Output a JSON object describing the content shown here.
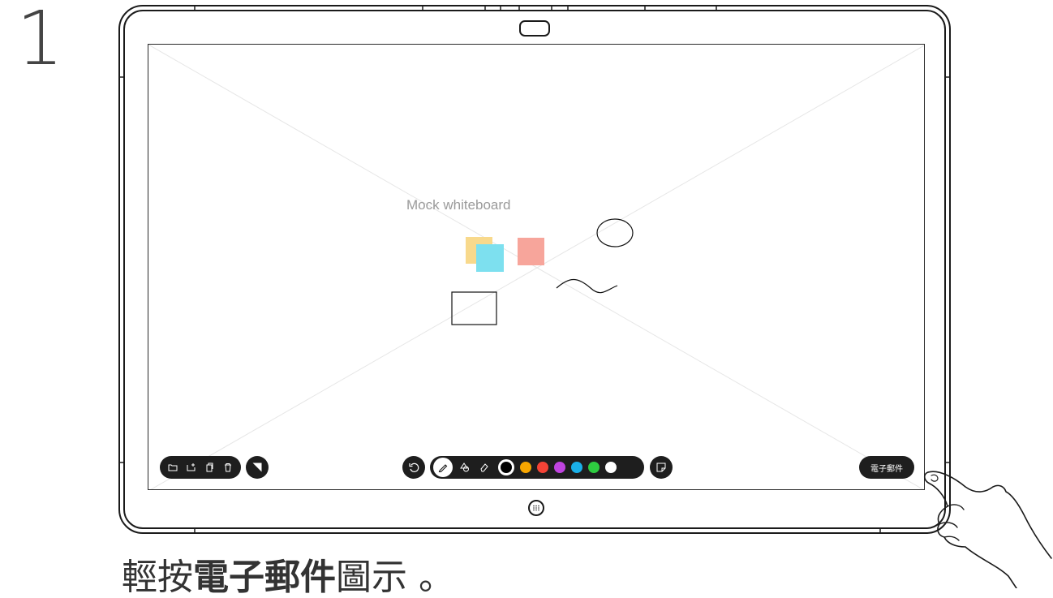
{
  "step": {
    "number": "1"
  },
  "whiteboard": {
    "mock_label": "Mock whiteboard",
    "email_button_label": "電子郵件",
    "left_toolbar": {
      "icons": [
        "folder-icon",
        "new-page-icon",
        "copy-icon",
        "delete-icon"
      ],
      "extra_icon": "background-toggle-icon"
    },
    "center_toolbar": {
      "undo_icon": "undo-icon",
      "tools": [
        "pen-icon",
        "shape-icon",
        "eraser-icon"
      ],
      "colors": [
        "#000000",
        "#f7a600",
        "#f44336",
        "#c044e0",
        "#1ab0e8",
        "#2ecc40",
        "#ffffff"
      ],
      "selected_color": "#000000",
      "sticky_icon": "sticky-note-icon"
    },
    "sticky_notes": {
      "colors": [
        "#f8d98c",
        "#7de0ef",
        "#f7a59b"
      ]
    }
  },
  "caption": {
    "prefix": "輕按",
    "emphasis": "電子郵件",
    "suffix": "圖示 。"
  }
}
